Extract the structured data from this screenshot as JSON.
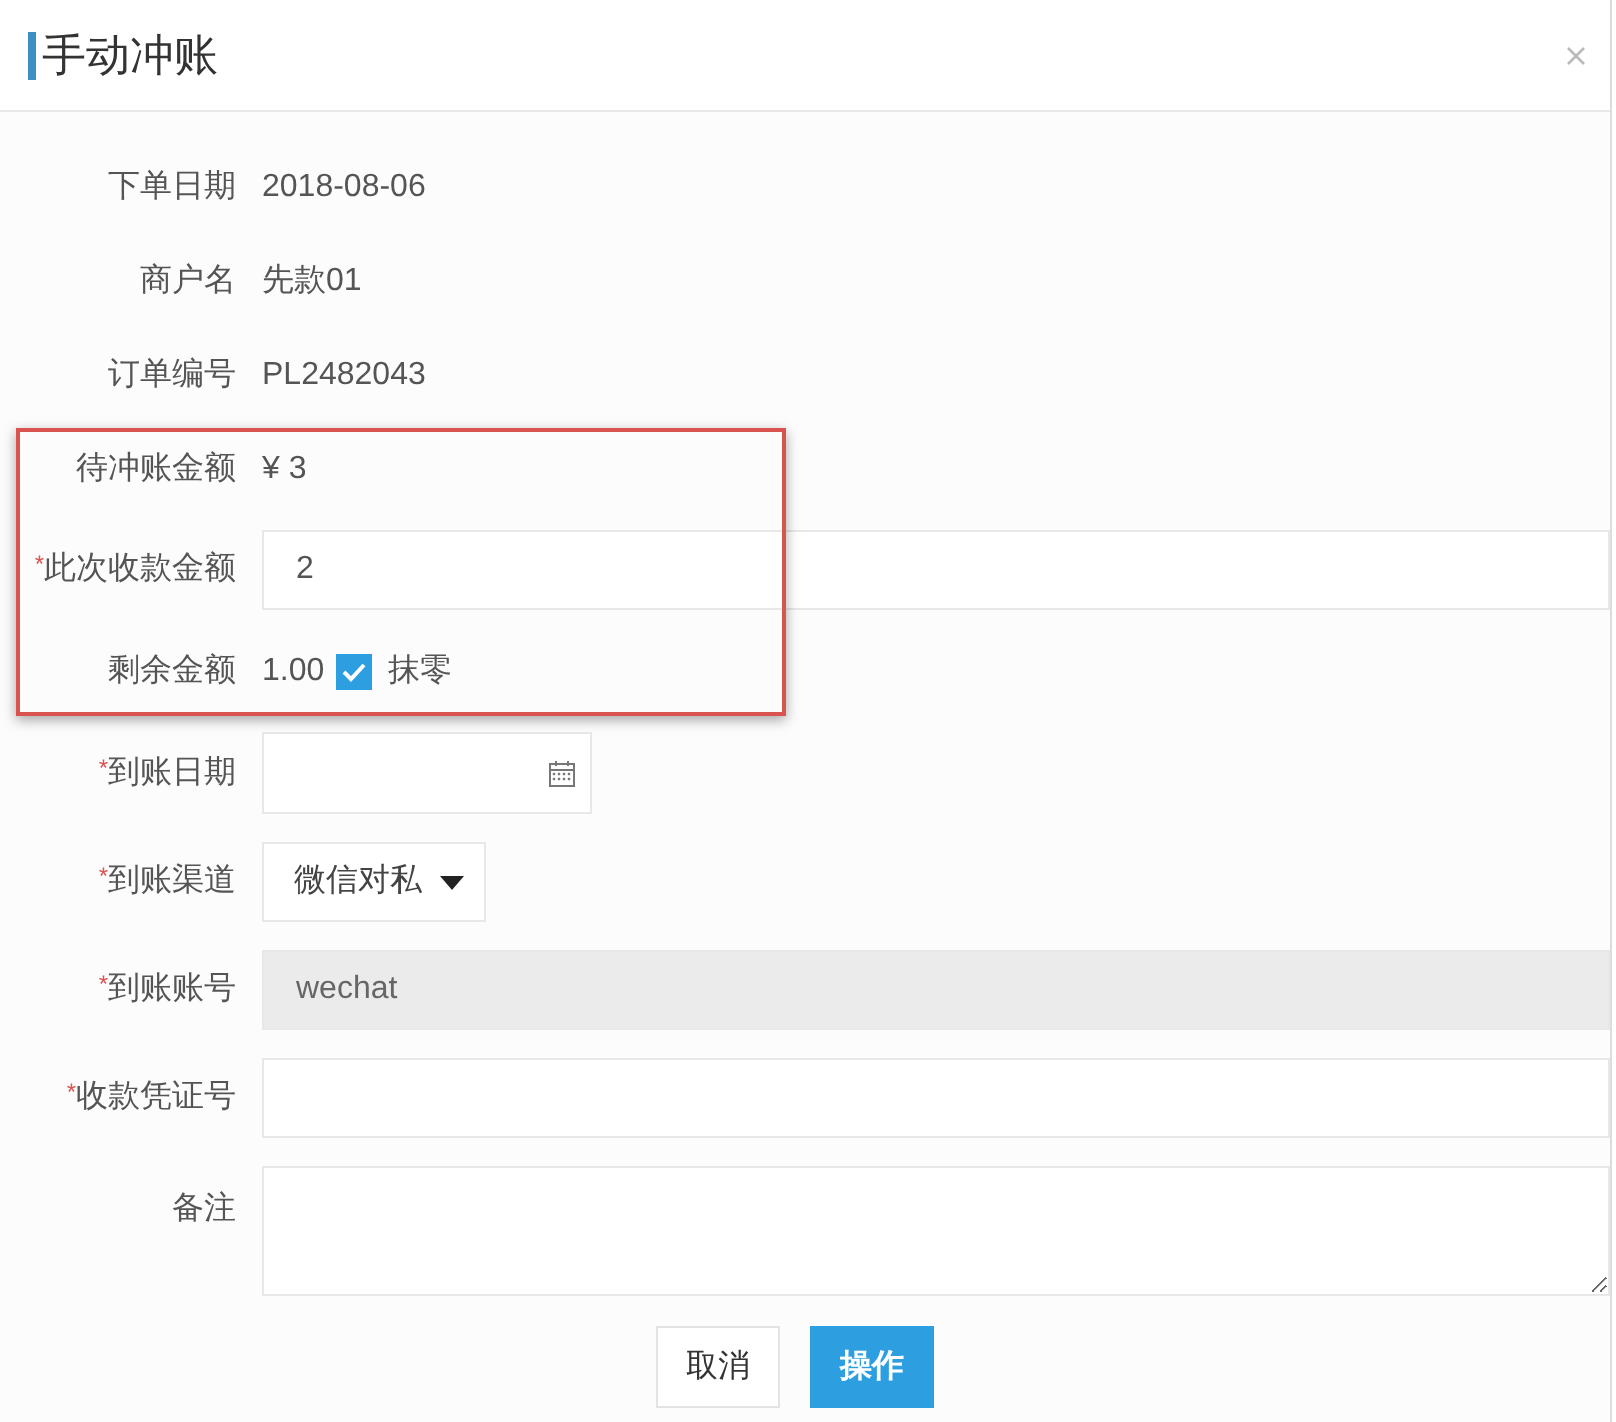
{
  "dialog": {
    "title": "手动冲账"
  },
  "fields": [
    {
      "kind": "text",
      "label": "下单日期",
      "value": "2018-08-06"
    },
    {
      "kind": "text",
      "label": "商户名",
      "value": "先款01"
    },
    {
      "kind": "text",
      "label": "订单编号",
      "value": "PL2482043"
    },
    {
      "kind": "text",
      "label": "待冲账金额",
      "value": "¥ 3"
    },
    {
      "kind": "input",
      "required_mark": "*",
      "label": "此次收款金额",
      "value": "2",
      "disabled": false
    },
    {
      "kind": "amount_checkbox",
      "label": "剩余金额",
      "value": "1.00",
      "checkbox": {
        "label": "抹零",
        "checked": true
      }
    },
    {
      "kind": "date",
      "required_mark": "*",
      "label": "到账日期"
    },
    {
      "kind": "select",
      "required_mark": "*",
      "label": "到账渠道",
      "value": "微信对私"
    },
    {
      "kind": "input",
      "required_mark": "*",
      "label": "到账账号",
      "value": "wechat",
      "disabled": true
    },
    {
      "kind": "input",
      "required_mark": "*",
      "label": "收款凭证号",
      "disabled": false
    },
    {
      "kind": "textarea",
      "label": "备注"
    }
  ],
  "buttons": [
    {
      "label": "取消",
      "kind": "default"
    },
    {
      "label": "操作",
      "kind": "primary"
    }
  ]
}
